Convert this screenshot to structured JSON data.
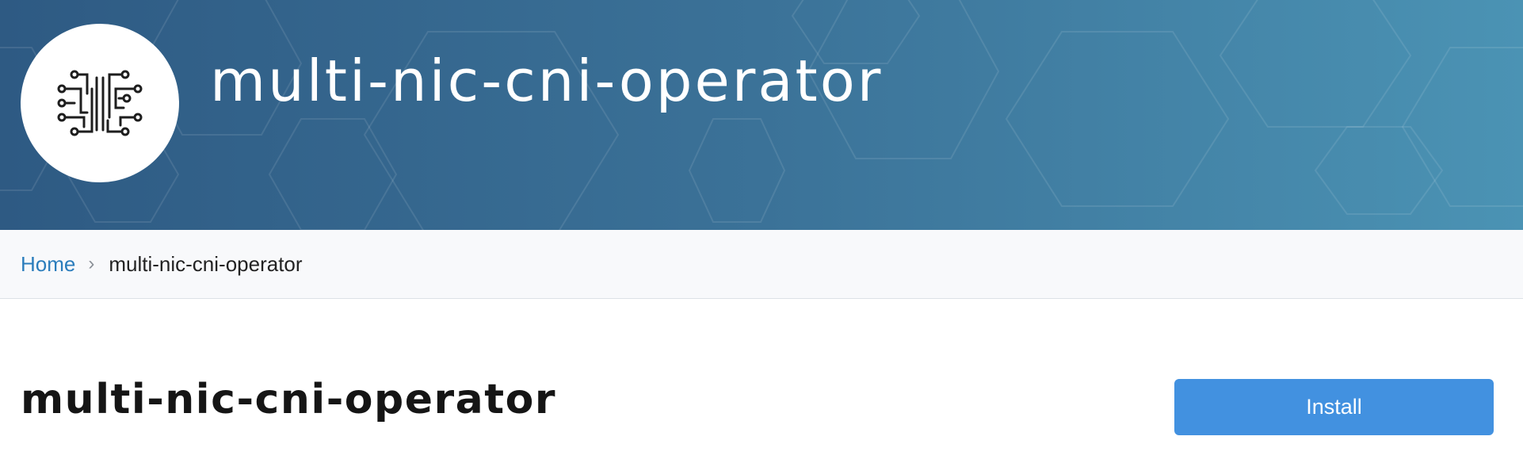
{
  "header": {
    "title": "multi-nic-cni-operator",
    "logo_icon": "circuit-chip-icon",
    "gradient_start": "#2e5a83",
    "gradient_end": "#4b93b4"
  },
  "breadcrumb": {
    "home_label": "Home",
    "separator_icon": "chevron-right-icon",
    "current_label": "multi-nic-cni-operator"
  },
  "main": {
    "title": "multi-nic-cni-operator",
    "install_label": "Install",
    "install_color": "#4291e0"
  }
}
